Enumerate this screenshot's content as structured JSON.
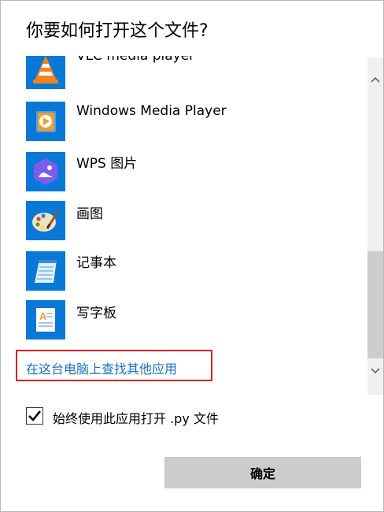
{
  "dialog": {
    "title": "你要如何打开这个文件?",
    "apps": [
      {
        "label": "VLC media player",
        "icon": "vlc-icon"
      },
      {
        "label": "Windows Media Player",
        "icon": "windows-media-player-icon"
      },
      {
        "label": "WPS 图片",
        "icon": "wps-picture-icon"
      },
      {
        "label": "画图",
        "icon": "paint-icon"
      },
      {
        "label": "记事本",
        "icon": "notepad-icon"
      },
      {
        "label": "写字板",
        "icon": "wordpad-icon"
      }
    ],
    "more_apps_link": "在这台电脑上查找其他应用",
    "always_use": {
      "label": "始终使用此应用打开 .py 文件",
      "checked": true
    },
    "ok_label": "确定"
  },
  "colors": {
    "accent": "#0a78d7",
    "link": "#1a70c8",
    "highlight_border": "#e01f1f",
    "button_bg": "#cccccc"
  }
}
